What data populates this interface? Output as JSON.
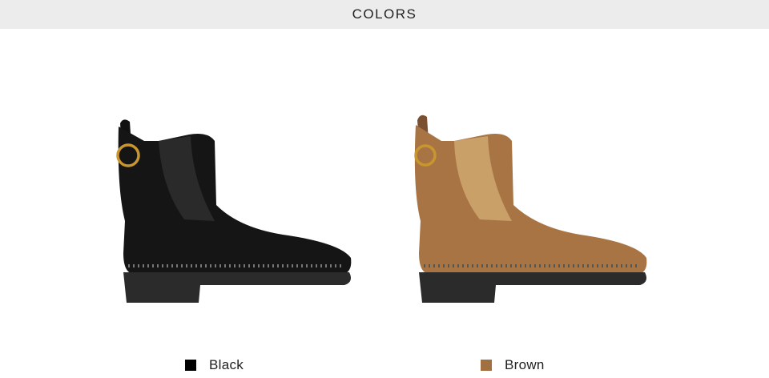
{
  "header": {
    "title": "COLORS"
  },
  "variants": [
    {
      "label": "Black",
      "swatch_color": "#000000",
      "image": "black-chelsea-boot"
    },
    {
      "label": "Brown",
      "swatch_color": "#a07041",
      "image": "brown-chelsea-boot"
    }
  ],
  "colors": {
    "header_band": "#ececec",
    "background": "#ffffff",
    "black_suede": "#151515",
    "black_elastic": "#2a2a2a",
    "brown_suede": "#a87444",
    "brown_elastic": "#c9a068",
    "sole": "#2b2b2b",
    "ring": "#c8962e"
  }
}
